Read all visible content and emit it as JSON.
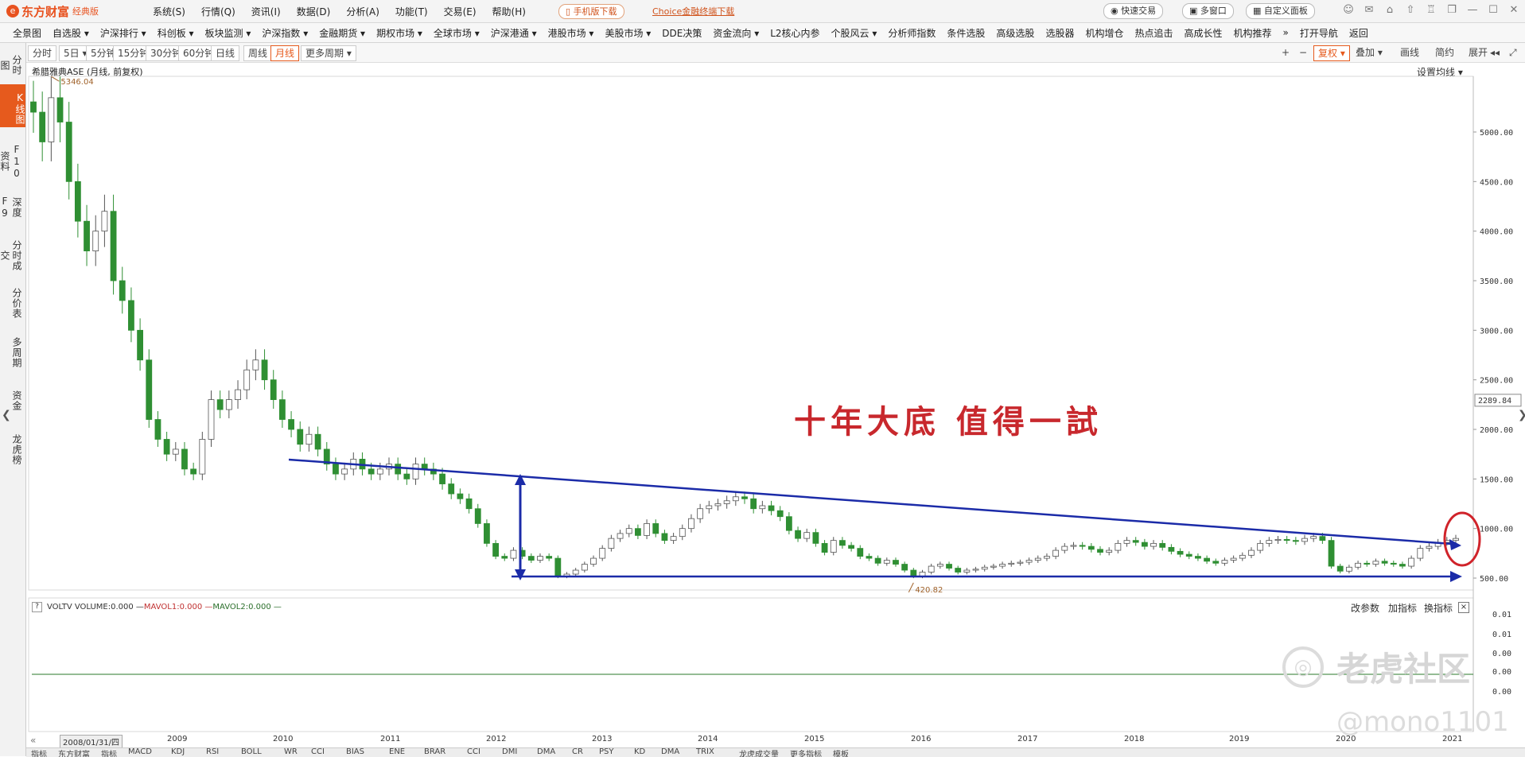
{
  "app": {
    "logo_mark": "e",
    "logo_text": "东方财富",
    "logo_sub": "经典版"
  },
  "topmenu": [
    "系统(S)",
    "行情(Q)",
    "资讯(I)",
    "数据(D)",
    "分析(A)",
    "功能(T)",
    "交易(E)",
    "帮助(H)"
  ],
  "topbar": {
    "mobile_download": "手机版下载",
    "choice_download": "Choice金融终端下载",
    "quick_trade": "快速交易",
    "multi_window": "多窗口",
    "custom_panel": "自定义面板"
  },
  "navbar": [
    "全景图",
    "自选股 ▾",
    "沪深排行 ▾",
    "科创板 ▾",
    "板块监测 ▾",
    "沪深指数 ▾",
    "金融期货 ▾",
    "期权市场 ▾",
    "全球市场 ▾",
    "沪深港通 ▾",
    "港股市场 ▾",
    "美股市场 ▾",
    "DDE决策",
    "资金流向 ▾",
    "L2核心内参",
    "个股风云 ▾",
    "分析师指数",
    "条件选股",
    "高级选股",
    "选股器",
    "机构增仓",
    "热点追击",
    "高成长性",
    "机构推荐",
    "»",
    "打开导航",
    "返回"
  ],
  "leftbar": [
    "分时图",
    "K线图",
    "F10资料",
    "深度F9",
    "分时成交",
    "分价表",
    "多周期",
    "资金",
    "龙虎榜"
  ],
  "periods": [
    "分时",
    "5日 ▾",
    "5分钟",
    "15分钟",
    "30分钟",
    "60分钟",
    "日线",
    "周线",
    "月线",
    "更多周期 ▾"
  ],
  "right_tools": {
    "plus": "+",
    "minus": "−",
    "fuquan": "复权 ▾",
    "overlay": "叠加 ▾",
    "draw": "画线",
    "simple": "简约",
    "expand": "展开"
  },
  "chart": {
    "title": "希腊雅典ASE (月线, 前复权)",
    "ma_setting": "设置均线 ▾",
    "price_label": "2289.84",
    "high_label": "5346.04",
    "low_label": "420.82",
    "annotation": "十年大底 值得一試",
    "y_ticks": [
      "5000.00",
      "4500.00",
      "4000.00",
      "3500.00",
      "3000.00",
      "2500.00",
      "2000.00",
      "1500.00",
      "1000.00",
      "500.00"
    ],
    "vol_ticks": [
      "0.01",
      "0.01",
      "0.00",
      "0.00",
      "0.00"
    ]
  },
  "chart_data": {
    "type": "candlestick",
    "title": "希腊雅典ASE (月线, 前复权)",
    "ylim": [
      380,
      5600
    ],
    "x_labels": [
      "2009",
      "2010",
      "2011",
      "2012",
      "2013",
      "2014",
      "2015",
      "2016",
      "2017",
      "2018",
      "2019",
      "2020",
      "2021"
    ],
    "x_start": "2008/01/31/四",
    "close": [
      5200,
      4900,
      5346,
      5100,
      4500,
      4100,
      3800,
      4000,
      4200,
      3500,
      3300,
      3000,
      2700,
      2100,
      1900,
      1750,
      1800,
      1600,
      1550,
      1900,
      2300,
      2200,
      2300,
      2400,
      2600,
      2700,
      2500,
      2300,
      2100,
      2000,
      1850,
      1950,
      1800,
      1650,
      1550,
      1600,
      1700,
      1600,
      1550,
      1600,
      1650,
      1550,
      1500,
      1650,
      1600,
      1550,
      1450,
      1350,
      1300,
      1200,
      1050,
      850,
      720,
      700,
      780,
      720,
      680,
      720,
      700,
      520,
      540,
      580,
      640,
      700,
      800,
      900,
      950,
      1000,
      930,
      1050,
      950,
      880,
      920,
      1000,
      1100,
      1200,
      1230,
      1250,
      1280,
      1320,
      1300,
      1200,
      1230,
      1180,
      1120,
      980,
      900,
      960,
      850,
      760,
      880,
      830,
      800,
      720,
      700,
      650,
      680,
      640,
      580,
      520,
      560,
      620,
      640,
      600,
      560,
      580,
      590,
      610,
      620,
      640,
      650,
      660,
      680,
      700,
      720,
      780,
      820,
      830,
      820,
      790,
      760,
      780,
      850,
      880,
      860,
      820,
      850,
      810,
      770,
      740,
      720,
      700,
      670,
      650,
      680,
      700,
      730,
      780,
      850,
      880,
      890,
      880,
      870,
      900,
      920,
      880,
      620,
      570,
      610,
      650,
      640,
      670,
      650,
      640,
      620,
      700,
      800,
      820,
      860,
      880,
      900
    ],
    "high_point": 5346.04,
    "low_point": 420.82,
    "last_price": 2289.84,
    "volume_series": "VOLTV VOLUME:0.000 — MAVOL1:0.000 — MAVOL2:0.000 —"
  },
  "volume": {
    "header_q": "?",
    "header_label": "VOLTV  VOLUME:0.000 — ",
    "mavol1": "MAVOL1:0.000 — ",
    "mavol2": "MAVOL2:0.000 —",
    "change_params": "改参数",
    "add_indicator": "加指标",
    "switch_indicator": "换指标",
    "close": "×"
  },
  "xaxis": {
    "start": "2008/01/31/四",
    "years": [
      "2009",
      "2010",
      "2011",
      "2012",
      "2013",
      "2014",
      "2015",
      "2016",
      "2017",
      "2018",
      "2019",
      "2020",
      "2021"
    ]
  },
  "bottombar": [
    "指标",
    "东方财富",
    "指标",
    "MACD",
    "KDJ",
    "RSI",
    "BOLL",
    "WR",
    "CCI",
    "BIAS",
    "ENE",
    "BRAR",
    "CCI",
    "DMI",
    "DMA",
    "CR",
    "PSY",
    "KD",
    "DMA",
    "TRIX",
    "龙虎成交量",
    "更多指标",
    "模板"
  ],
  "watermark": {
    "circle": "◎",
    "text": "老虎社区",
    "handle": "@mono1101"
  },
  "colors": {
    "up": "#d0232a",
    "down": "#2f8f33",
    "trendline": "#1b2ba8",
    "circle": "#d0232a",
    "accent": "#e65a1d"
  }
}
